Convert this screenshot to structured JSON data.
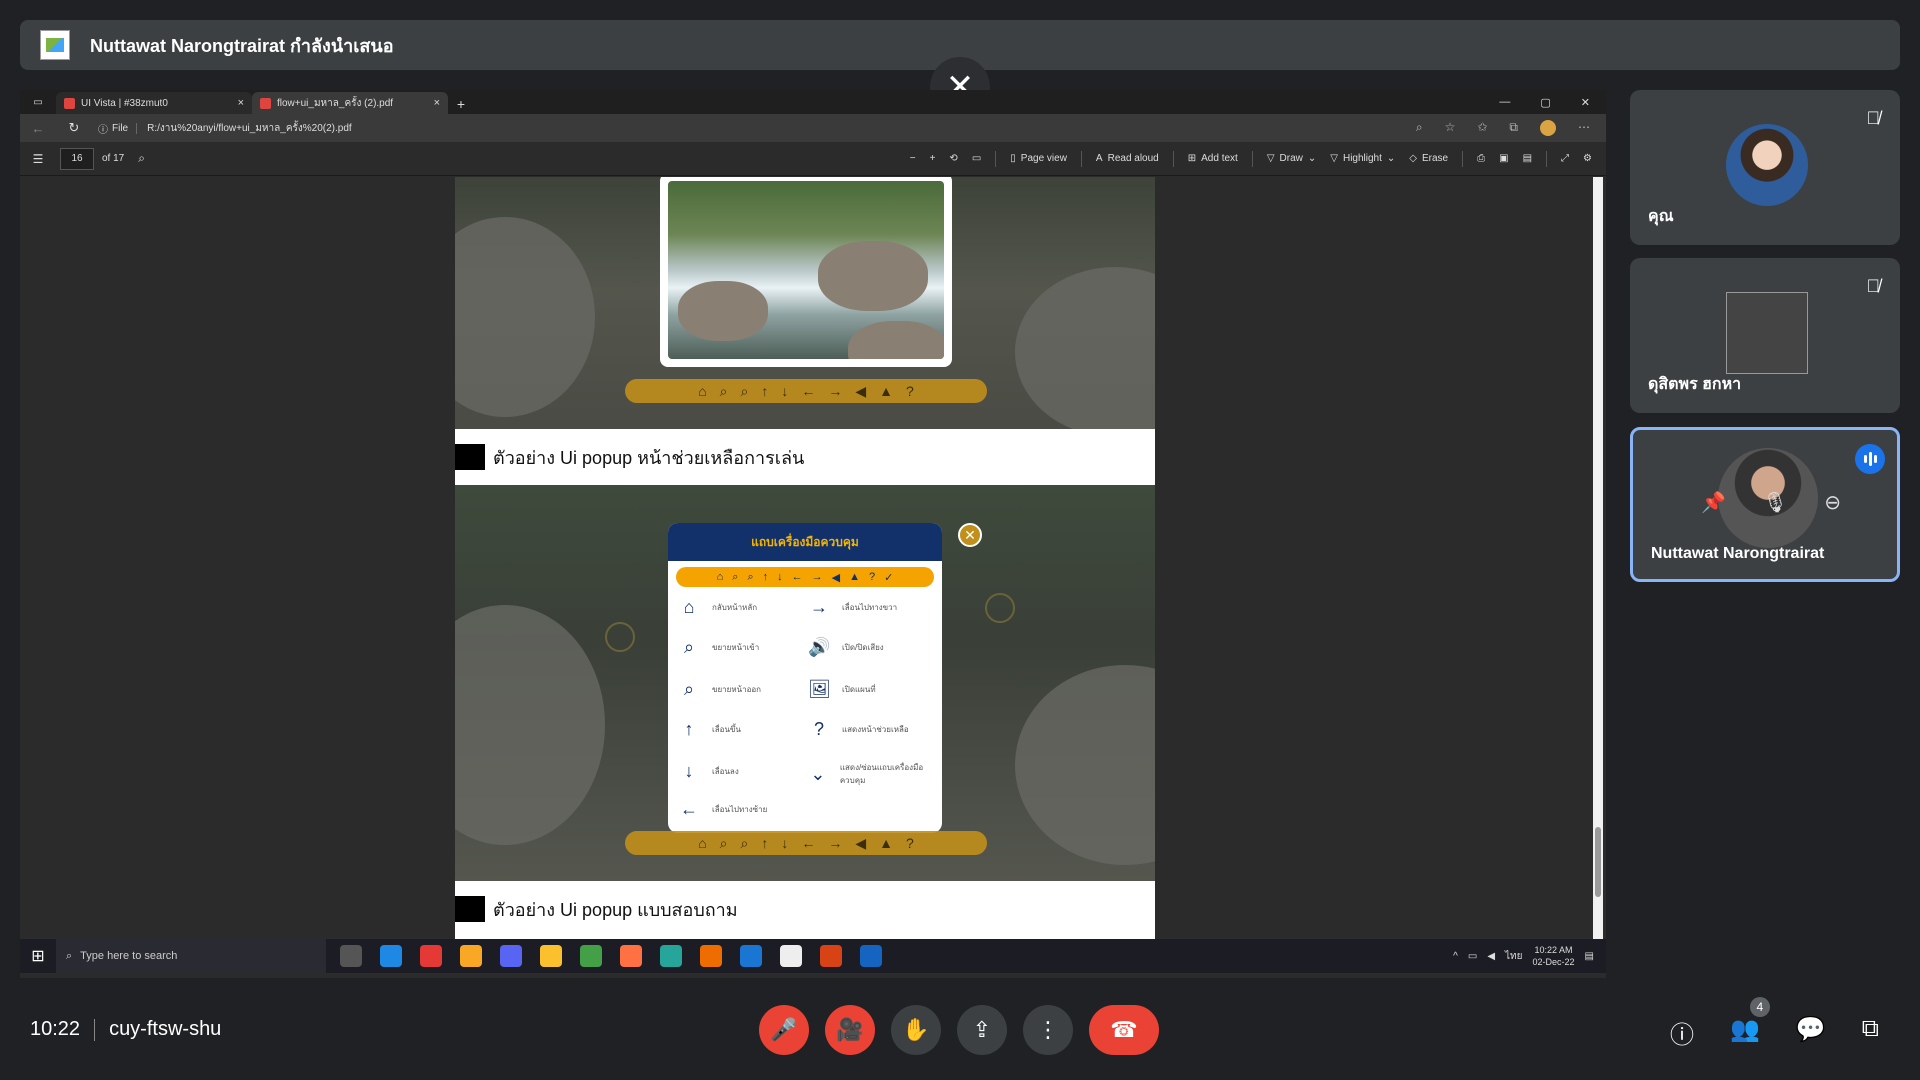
{
  "presenter_banner": {
    "text": "Nuttawat Narongtrairat กำลังนำเสนอ"
  },
  "close_share_label": "✕",
  "browser": {
    "tabs": [
      {
        "title": "UI Vista | #38zmut0",
        "close": "×"
      },
      {
        "title": "flow+ui_มหาล_ครั้ง (2).pdf",
        "close": "×"
      }
    ],
    "new_tab": "+",
    "window_controls": [
      "—",
      "▢",
      "✕"
    ],
    "address": {
      "scheme": "File",
      "url": "R:/งาน%20anyi/flow+ui_มหาล_ครั้ง%20(2).pdf"
    }
  },
  "pdf_toolbar": {
    "page_current": "16",
    "page_total": "of 17",
    "tools": [
      "Page view",
      "Read aloud",
      "Add text",
      "Draw",
      "Highlight",
      "Erase"
    ]
  },
  "pdf_content": {
    "caption1": "ตัวอย่าง Ui popup หน้าช่วยเหลือการเล่น",
    "popup_title": "แถบเครื่องมือควบคุม",
    "popup_items": [
      {
        "icon": "⌂",
        "label": "กลับหน้าหลัก"
      },
      {
        "icon": "⌕",
        "label": "ขยายหน้าเข้า"
      },
      {
        "icon": "⌕",
        "label": "ขยายหน้าออก"
      },
      {
        "icon": "↑",
        "label": "เลื่อนขึ้น"
      },
      {
        "icon": "↓",
        "label": "เลื่อนลง"
      },
      {
        "icon": "←",
        "label": "เลื่อนไปทางซ้าย"
      },
      {
        "icon": "→",
        "label": "เลื่อนไปทางขวา"
      },
      {
        "icon": "🔊",
        "label": "เปิด/ปิดเสียง"
      },
      {
        "icon": "🖼",
        "label": "เปิดแผนที่"
      },
      {
        "icon": "?",
        "label": "แสดงหน้าช่วยเหลือ"
      },
      {
        "icon": "⌄",
        "label": "แสดง/ซ่อนแถบเครื่องมือควบคุม"
      }
    ],
    "caption2": "ตัวอย่าง Ui popup แบบสอบถาม"
  },
  "taskbar": {
    "search_placeholder": "Type here to search",
    "time": "10:22 AM",
    "date": "02-Dec-22",
    "lang": "ไทย"
  },
  "participants": [
    {
      "name": "คุณ",
      "muted": true
    },
    {
      "name": "ดุสิตพร ฮกหา",
      "muted": true
    },
    {
      "name": "Nuttawat Narongtrairat",
      "speaking": true
    }
  ],
  "meeting": {
    "time": "10:22",
    "code": "cuy-ftsw-shu",
    "participant_count": "4"
  },
  "colors": {
    "accent": "#1a73e8",
    "danger": "#ea4335",
    "background": "#202124"
  }
}
